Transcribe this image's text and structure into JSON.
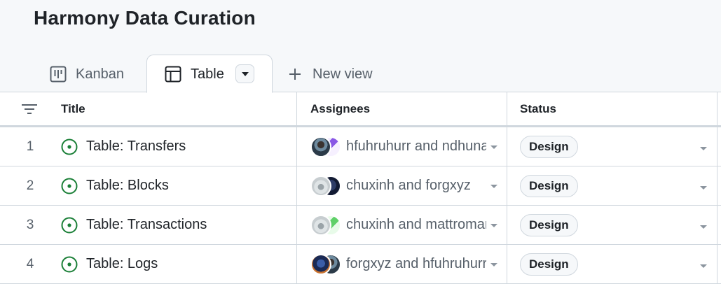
{
  "project": {
    "title": "Harmony Data Curation"
  },
  "views": [
    {
      "label": "Kanban",
      "icon": "kanban-icon",
      "active": false
    },
    {
      "label": "Table",
      "icon": "table-icon",
      "active": true
    },
    {
      "label": "New view",
      "icon": "plus-icon",
      "active": false
    }
  ],
  "columns": {
    "title": "Title",
    "assignees": "Assignees",
    "status": "Status"
  },
  "colors": {
    "open_status": "#1a7f37",
    "border": "#d0d7de",
    "muted": "#57606a"
  },
  "rows": [
    {
      "num": "1",
      "title": "Table: Transfers",
      "assignees": "hfuhruhurr and ndhuna",
      "status": "Design"
    },
    {
      "num": "2",
      "title": "Table: Blocks",
      "assignees": "chuxinh and forgxyz",
      "status": "Design"
    },
    {
      "num": "3",
      "title": "Table: Transactions",
      "assignees": "chuxinh and mattromanis",
      "status": "Design"
    },
    {
      "num": "4",
      "title": "Table: Logs",
      "assignees": "forgxyz and hfuhruhurr",
      "status": "Design"
    }
  ]
}
